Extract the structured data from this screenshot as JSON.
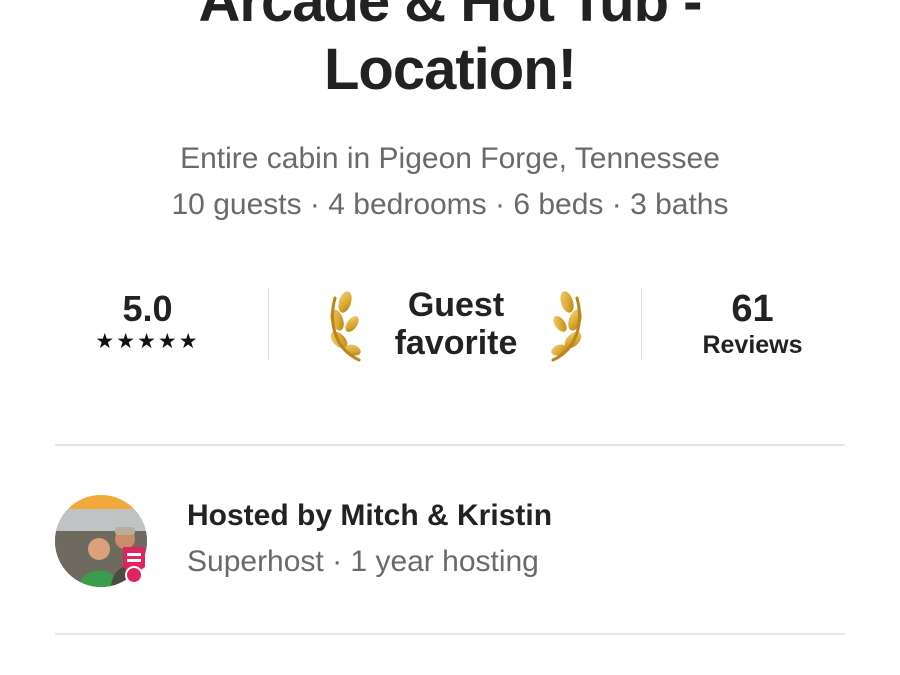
{
  "listing": {
    "title_line1": "Arcade & Hot Tub -",
    "title_line2": "Location!",
    "subtitle_line1": "Entire cabin in Pigeon Forge, Tennessee",
    "subtitle_line2": "10 guests · 4 bedrooms · 6 beds · 3 baths"
  },
  "stats": {
    "rating_value": "5.0",
    "rating_stars": "★★★★★",
    "rating_stars_count": 5,
    "guest_favorite_line1": "Guest",
    "guest_favorite_line2": "favorite",
    "reviews_count": "61",
    "reviews_label": "Reviews"
  },
  "host": {
    "name_line": "Hosted by Mitch & Kristin",
    "meta_line": "Superhost · 1 year hosting"
  },
  "icons": {
    "laurel_left": "laurel-left-icon",
    "laurel_right": "laurel-right-icon",
    "superhost_badge": "superhost-badge-icon"
  },
  "colors": {
    "text_primary": "#222222",
    "text_secondary": "#6a6a6a",
    "divider": "#dddddd",
    "laurel_gold": "#d9a62e",
    "superhost_pink": "#e0245e"
  }
}
